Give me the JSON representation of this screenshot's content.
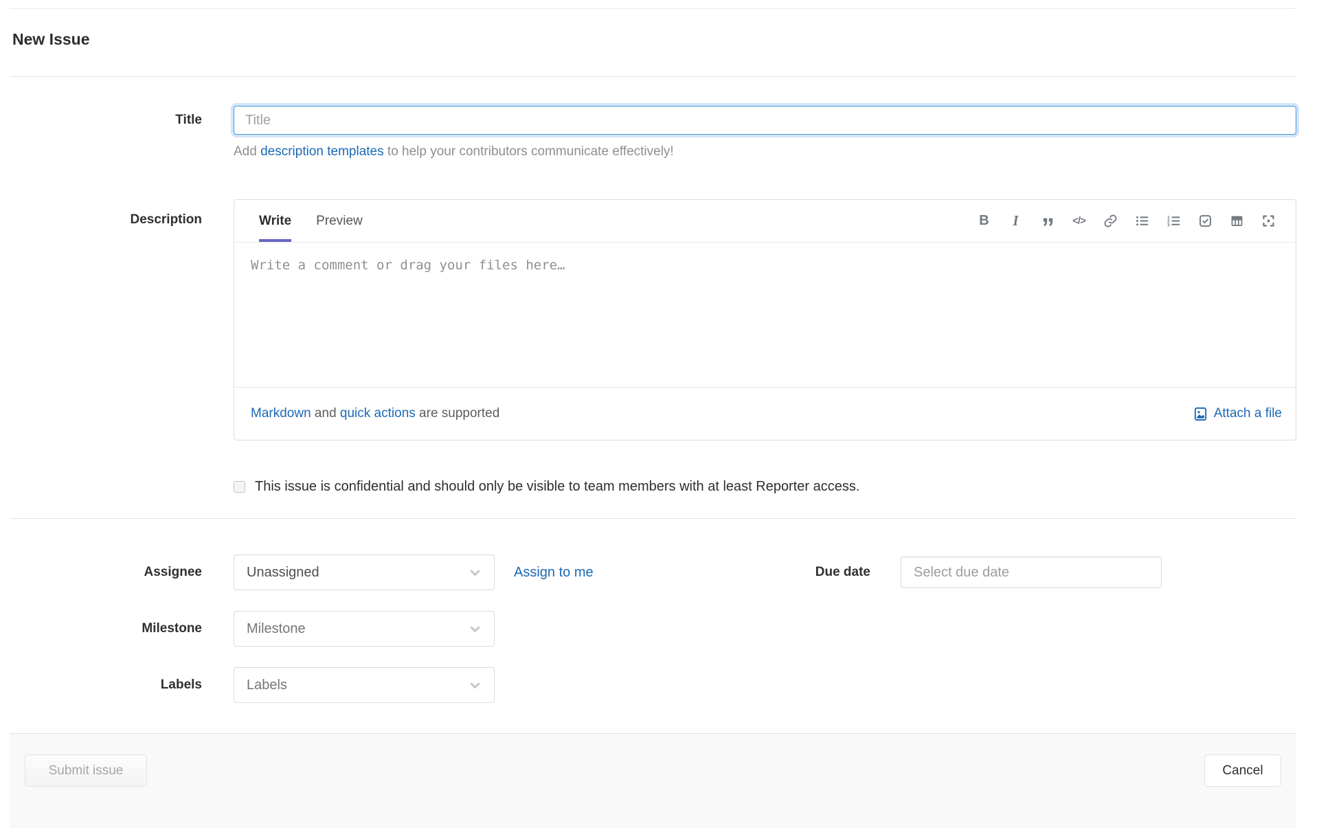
{
  "page": {
    "title": "New Issue"
  },
  "form": {
    "title": {
      "label": "Title",
      "value": "",
      "placeholder": "Title"
    },
    "title_help": {
      "prefix": "Add ",
      "link": "description templates",
      "suffix": " to help your contributors communicate effectively!"
    },
    "description": {
      "label": "Description",
      "tabs": [
        {
          "label": "Write",
          "active": true
        },
        {
          "label": "Preview",
          "active": false
        }
      ],
      "toolbar_icons": [
        "bold-icon",
        "italic-icon",
        "quote-icon",
        "code-icon",
        "link-icon",
        "bulleted-list-icon",
        "numbered-list-icon",
        "task-list-icon",
        "table-icon",
        "fullscreen-icon"
      ],
      "placeholder": "Write a comment or drag your files here…",
      "footer": {
        "markdown_link": "Markdown",
        "and": " and ",
        "quick_actions_link": "quick actions",
        "suffix": " are supported",
        "attach_label": "Attach a file"
      }
    },
    "confidential": {
      "checked": false,
      "label": "This issue is confidential and should only be visible to team members with at least Reporter access."
    },
    "assignee": {
      "label": "Assignee",
      "value": "Unassigned",
      "assign_link": "Assign to me"
    },
    "due_date": {
      "label": "Due date",
      "value": "",
      "placeholder": "Select due date"
    },
    "milestone": {
      "label": "Milestone",
      "value": "Milestone"
    },
    "labels": {
      "label": "Labels",
      "value": "Labels"
    }
  },
  "actions": {
    "submit_label": "Submit issue",
    "cancel_label": "Cancel"
  },
  "colors": {
    "link_blue": "#1b69b6",
    "focus_border": "#459be0",
    "active_tab_underline": "#6666c4",
    "toolbar_icon": "#72787f",
    "disabled_button_text": "#a6a6a6",
    "action_bar_bg": "#f9f9f9"
  }
}
